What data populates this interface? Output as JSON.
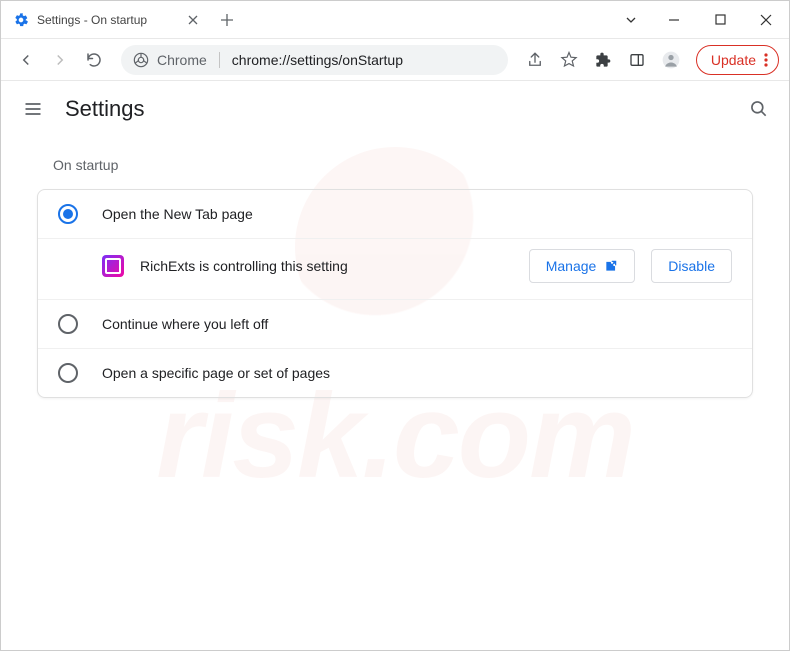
{
  "window": {
    "tab_title": "Settings - On startup",
    "url_origin": "Chrome",
    "url_path": "chrome://settings/onStartup",
    "update_label": "Update"
  },
  "header": {
    "title": "Settings"
  },
  "section": {
    "title": "On startup"
  },
  "options": [
    {
      "label": "Open the New Tab page",
      "selected": true
    },
    {
      "label": "Continue where you left off",
      "selected": false
    },
    {
      "label": "Open a specific page or set of pages",
      "selected": false
    }
  ],
  "controller": {
    "extension_name": "RichExts",
    "message": "RichExts is controlling this setting",
    "manage_label": "Manage",
    "disable_label": "Disable"
  }
}
